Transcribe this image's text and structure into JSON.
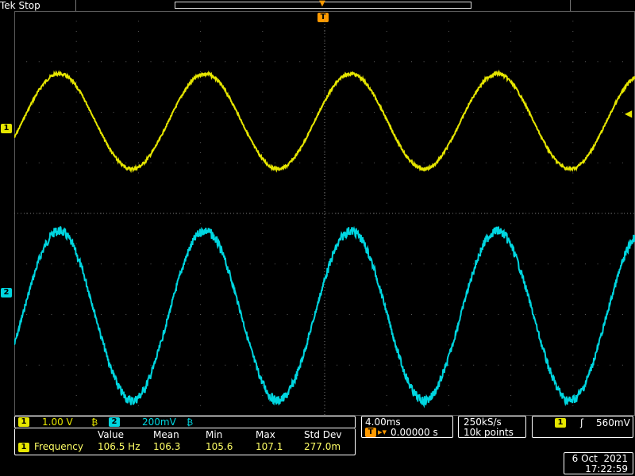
{
  "header": {
    "brand": "Tek",
    "acq_state": "Stop",
    "trigger_marker": "T"
  },
  "channels": [
    {
      "id": "1",
      "scale": "1.00 V",
      "color": "#e6e600",
      "coupling_icon": "bandwidth-limit-icon"
    },
    {
      "id": "2",
      "scale": "200mV",
      "color": "#00d6e0",
      "coupling_icon": "bandwidth-limit-icon"
    }
  ],
  "horizontal": {
    "time_per_div": "4.00ms",
    "trigger_position": "0.00000 s"
  },
  "acquisition": {
    "sample_rate": "250kS/s",
    "record_length": "10k points"
  },
  "trigger": {
    "source": "1",
    "slope_icon": "rising-edge-icon",
    "level": "560mV"
  },
  "measurements": {
    "headers": [
      "Value",
      "Mean",
      "Min",
      "Max",
      "Std Dev"
    ],
    "rows": [
      {
        "channel": "1",
        "name": "Frequency",
        "value": "106.5 Hz",
        "mean": "106.3",
        "min": "105.6",
        "max": "107.1",
        "std_dev": "277.0m"
      }
    ]
  },
  "datetime": {
    "date": "6 Oct  2021",
    "time": "17:22:59"
  },
  "waveforms": {
    "ch1": {
      "cycles_visible": 4.25,
      "frequency_hz": 106.5
    },
    "ch2": {
      "cycles_visible": 4.25,
      "frequency_hz": 106.5
    }
  },
  "colors": {
    "ch1": "#e6e600",
    "ch2": "#00d6e0",
    "trigger": "#ff9a00",
    "grid": "#5a5a5a"
  }
}
